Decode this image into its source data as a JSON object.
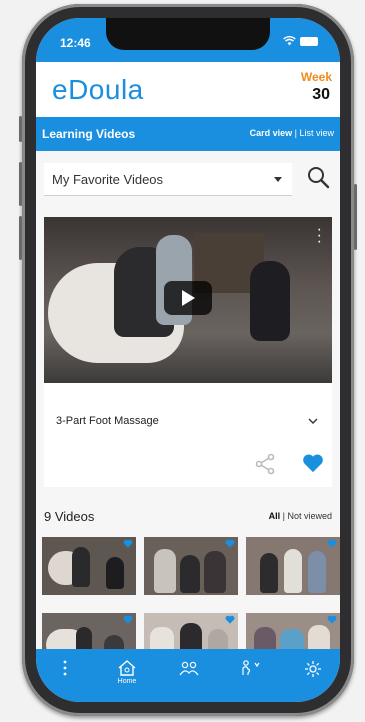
{
  "status": {
    "time": "12:46"
  },
  "app": {
    "logo": "eDoula",
    "week_label": "Week",
    "week_number": "30"
  },
  "section": {
    "title": "Learning Videos",
    "card_view": "Card view",
    "separator": "|",
    "list_view": "List view"
  },
  "filter_dropdown": {
    "selected": "My Favorite Videos"
  },
  "featured": {
    "title": "3-Part Foot Massage",
    "favorited": true
  },
  "list": {
    "count_label": "9 Videos",
    "filter_all": "All",
    "filter_separator": "|",
    "filter_not_viewed": "Not viewed"
  },
  "thumbnails": [
    {
      "favorited": true
    },
    {
      "favorited": true
    },
    {
      "favorited": true
    },
    {
      "favorited": true
    },
    {
      "favorited": true
    },
    {
      "favorited": true
    }
  ],
  "nav": {
    "items": [
      {
        "icon": "more-vertical-icon",
        "label": ""
      },
      {
        "icon": "home-icon",
        "label": "Home"
      },
      {
        "icon": "group-icon",
        "label": ""
      },
      {
        "icon": "pregnant-icon",
        "label": ""
      },
      {
        "icon": "settings-icon",
        "label": ""
      }
    ]
  },
  "colors": {
    "brand": "#1a8fdf",
    "accent": "#f08a1c",
    "heart": "#1a8fdf"
  }
}
